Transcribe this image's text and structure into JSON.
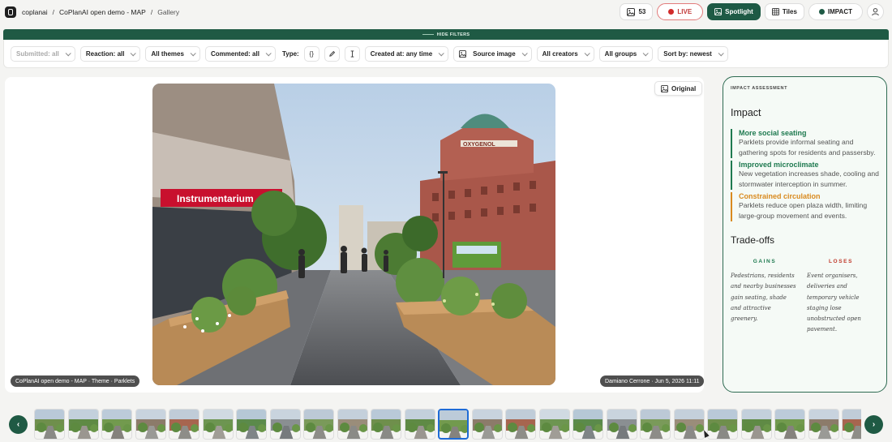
{
  "breadcrumb": {
    "org": "coplanai",
    "project": "CoPlanAI open demo - MAP",
    "page": "Gallery"
  },
  "toolbar": {
    "count": "53",
    "live": "LIVE",
    "spotlight": "Spotlight",
    "tiles": "Tiles",
    "impact": "IMPACT"
  },
  "filters": {
    "hide": "HIDE FILTERS",
    "submitted": "Submitted: all",
    "reaction": "Reaction: all",
    "themes": "All themes",
    "commented": "Commented: all",
    "type_label": "Type:",
    "created": "Created at: any time",
    "source": "Source image",
    "creators": "All creators",
    "groups": "All groups",
    "sort": "Sort by: newest"
  },
  "viewer": {
    "original_label": "Original",
    "caption_left": "CoPlanAI open demo - MAP · Theme · Parklets",
    "caption_right": "Damiano Cerrone · Jun 5, 2026 11:11",
    "photo_sign": "Instrumentarium",
    "photo_building_sign": "OXYGENOL"
  },
  "impact": {
    "section": "IMPACT ASSESSMENT",
    "heading": "Impact",
    "items": [
      {
        "title": "More social seating",
        "text": "Parklets provide informal seating and gathering spots for residents and passersby.",
        "color": "#1f7a50"
      },
      {
        "title": "Improved microclimate",
        "text": "New vegetation increases shade, cooling and stormwater interception in summer.",
        "color": "#1f7a50"
      },
      {
        "title": "Constrained circulation",
        "text": "Parklets reduce open plaza width, limiting large-group movement and events.",
        "color": "#d98a1f"
      }
    ],
    "tradeoffs": "Trade-offs",
    "gains_label": "GAINS",
    "gains_text": "Pedestrians, residents and nearby businesses gain seating, shade and attractive greenery.",
    "loses_label": "LOSES",
    "loses_text": "Event organisers, deliveries and temporary vehicle staging lose unobstructed open pavement."
  },
  "colors": {
    "brand": "#1f5a44",
    "live": "#d12b2b",
    "gains": "#1f7a50",
    "loses": "#c0392b",
    "active_thumb": "#1e6bd6"
  },
  "thumbnails": {
    "count": 25,
    "active_index": 12
  }
}
